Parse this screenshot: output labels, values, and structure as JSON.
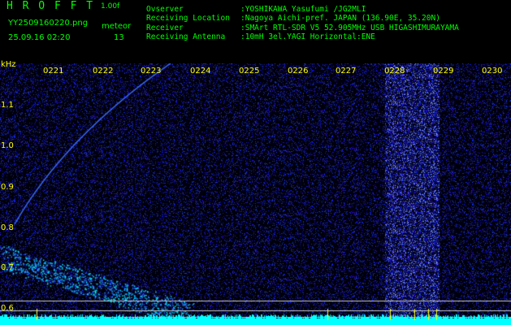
{
  "header": {
    "logo": "H R O F F T",
    "version": "1.00f",
    "filename": "YY2509160220.png",
    "datetime": "25.09.16 02:20",
    "meteor_label": "meteor",
    "meteor_count": "13"
  },
  "info": {
    "labels": [
      "Ovserver",
      "Receiving Location",
      "Receiver",
      "Receiving Antenna"
    ],
    "values": [
      ":YOSHIKAWA Yasufumi /JG2MLI",
      ":Nagoya Aichi-pref. JAPAN (136.90E, 35.20N)",
      ":SMArt RTL-SDR V5 52.905MHz USB HIGASHIMURAYAMA",
      ":10mH 3el.YAGI Horizontal:ENE"
    ]
  },
  "axis": {
    "unit": "kHz",
    "freq_labels": [
      "1.1",
      "1.0",
      "0.9",
      "0.8",
      "0.7",
      "0.6"
    ],
    "time_labels": [
      "0221",
      "0222",
      "0223",
      "0224",
      "0225",
      "0226",
      "0227",
      "0228",
      "0229",
      "0230"
    ]
  },
  "colors": {
    "text": "#00ff00",
    "labels": "#ffff00",
    "background": "#000000",
    "noise": "#1a2bff",
    "signal": "#00ffff"
  }
}
